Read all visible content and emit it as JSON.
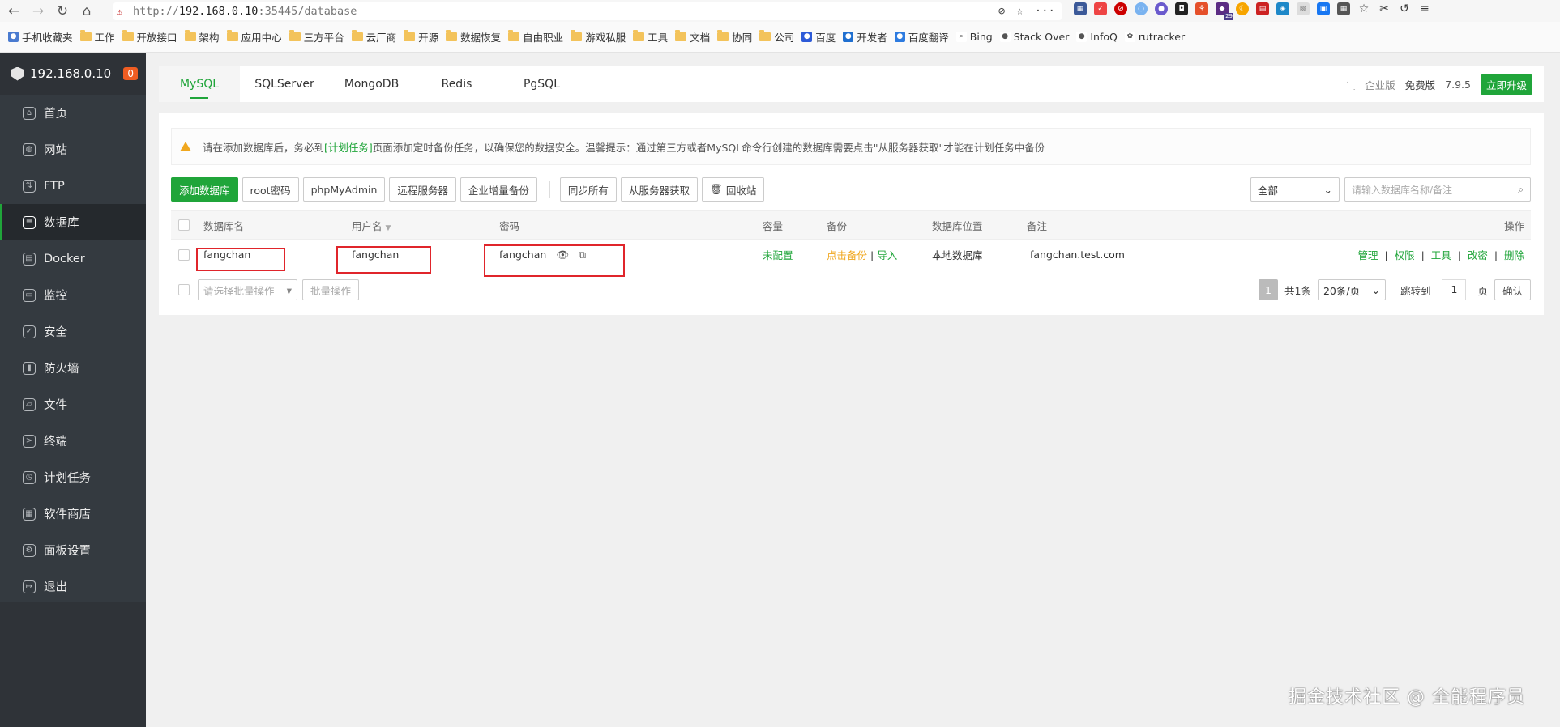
{
  "browser": {
    "url_scheme": "http://",
    "url_host": "192.168.0.10",
    "url_rest": ":35445/database",
    "bookmarks": [
      "手机收藏夹",
      "工作",
      "开放接口",
      "架构",
      "应用中心",
      "三方平台",
      "云厂商",
      "开源",
      "数据恢复",
      "自由职业",
      "游戏私服",
      "工具",
      "文档",
      "协同",
      "公司",
      "百度",
      "开发者",
      "百度翻译",
      "Bing",
      "Stack Over",
      "InfoQ",
      "rutracker"
    ],
    "ext_badge": "29"
  },
  "sidebar": {
    "host": "192.168.0.10",
    "badge": "0",
    "items": [
      {
        "label": "首页",
        "icon": "home-icon"
      },
      {
        "label": "网站",
        "icon": "globe-icon"
      },
      {
        "label": "FTP",
        "icon": "ftp-icon"
      },
      {
        "label": "数据库",
        "icon": "database-icon"
      },
      {
        "label": "Docker",
        "icon": "docker-icon"
      },
      {
        "label": "监控",
        "icon": "monitor-icon"
      },
      {
        "label": "安全",
        "icon": "shield-icon"
      },
      {
        "label": "防火墙",
        "icon": "firewall-icon"
      },
      {
        "label": "文件",
        "icon": "folder-icon"
      },
      {
        "label": "终端",
        "icon": "terminal-icon"
      },
      {
        "label": "计划任务",
        "icon": "clock-icon"
      },
      {
        "label": "软件商店",
        "icon": "grid-icon"
      },
      {
        "label": "面板设置",
        "icon": "gear-icon"
      },
      {
        "label": "退出",
        "icon": "logout-icon"
      }
    ]
  },
  "tabs": [
    "MySQL",
    "SQLServer",
    "MongoDB",
    "Redis",
    "PgSQL"
  ],
  "edition": {
    "enterprise": "企业版",
    "free": "免费版",
    "version": "7.9.5",
    "upgrade": "立即升级"
  },
  "notice": {
    "prefix": "请在添加数据库后，务必到",
    "link": "[计划任务]",
    "suffix": "页面添加定时备份任务，以确保您的数据安全。温馨提示：通过第三方或者MySQL命令行创建的数据库需要点击\"从服务器获取\"才能在计划任务中备份"
  },
  "toolbar": {
    "add": "添加数据库",
    "root": "root密码",
    "pma": "phpMyAdmin",
    "remote": "远程服务器",
    "incr": "企业增量备份",
    "sync": "同步所有",
    "fetch": "从服务器获取",
    "recycle": "回收站",
    "filter": "全部",
    "search_placeholder": "请输入数据库名称/备注"
  },
  "table": {
    "headers": {
      "name": "数据库名",
      "user": "用户名",
      "password": "密码",
      "size": "容量",
      "backup": "备份",
      "location": "数据库位置",
      "remark": "备注",
      "ops": "操作"
    },
    "rows": [
      {
        "name": "fangchan",
        "user": "fangchan",
        "password": "fangchan",
        "size": "未配置",
        "backup": "点击备份",
        "import": "导入",
        "location": "本地数据库",
        "remark": "fangchan.test.com",
        "ops": [
          "管理",
          "权限",
          "工具",
          "改密",
          "删除"
        ]
      }
    ]
  },
  "pager": {
    "batch_placeholder": "请选择批量操作",
    "batch_btn": "批量操作",
    "page": "1",
    "total": "共1条",
    "per_page": "20条/页",
    "jump": "跳转到",
    "jump_value": "1",
    "page_unit": "页",
    "confirm": "确认"
  },
  "watermark": "掘金技术社区 @ 全能程序员"
}
